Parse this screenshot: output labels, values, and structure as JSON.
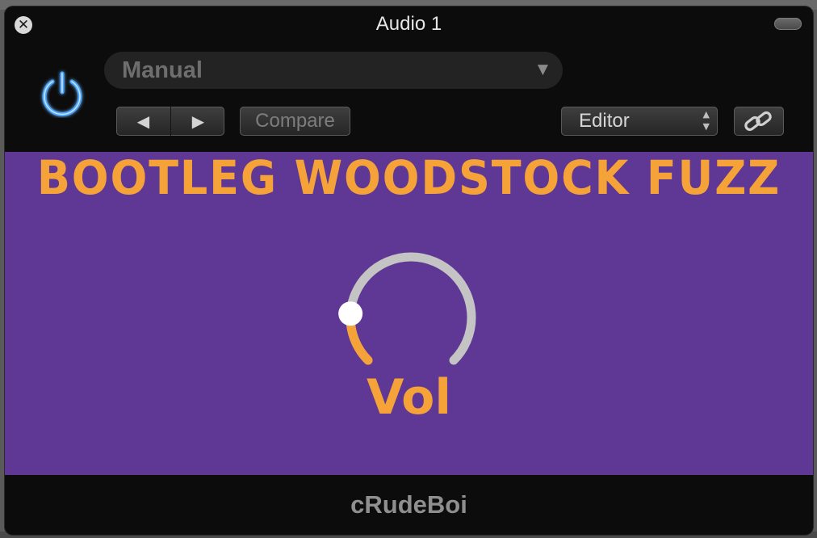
{
  "window": {
    "title": "Audio 1",
    "close_glyph": "✕",
    "icons": {
      "close": "close-icon",
      "collapse": "collapse-icon",
      "power": "power-icon",
      "link": "link-icon"
    }
  },
  "toolbar": {
    "preset": "Manual",
    "preset_arrow": "▼",
    "prev_glyph": "◀",
    "next_glyph": "▶",
    "compare_label": "Compare",
    "view_mode": "Editor",
    "view_arrows": "▲\n▼",
    "power_on": true,
    "power_color": "#4aa6ff"
  },
  "plugin": {
    "title": "BOOTLEG WOODSTOCK FUZZ",
    "knob_label": "Vol",
    "knob_value": 0.18,
    "accent_color": "#f5a238",
    "background_color": "#5f3895",
    "track_color": "#c4c4c4"
  },
  "footer": {
    "name": "cRudeBoi"
  }
}
